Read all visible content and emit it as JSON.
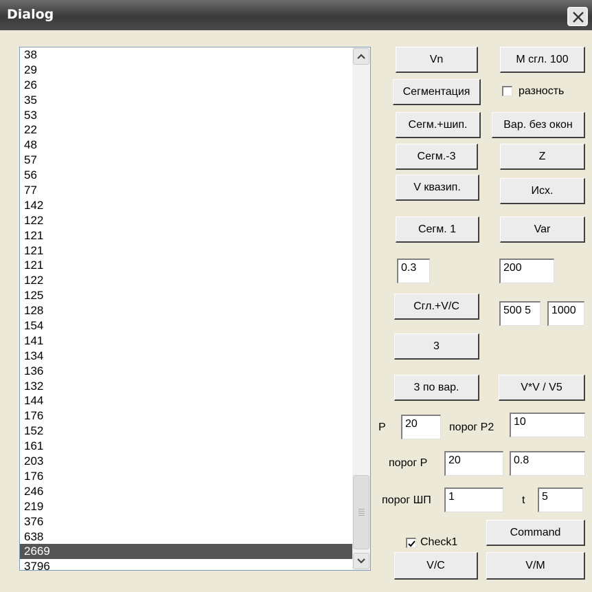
{
  "window": {
    "title": "Dialog"
  },
  "list": {
    "items": [
      "38",
      "29",
      "26",
      "35",
      "53",
      "22",
      "48",
      "57",
      "56",
      "77",
      "142",
      "122",
      "121",
      "121",
      "121",
      "122",
      "125",
      "128",
      "154",
      "141",
      "134",
      "136",
      "132",
      "144",
      "176",
      "152",
      "161",
      "203",
      "176",
      "246",
      "219",
      "376",
      "638",
      "2669",
      "3796"
    ],
    "selected_index": 33
  },
  "buttons": {
    "vn": "Vn",
    "m_sgl_100": "М сгл. 100",
    "segmentation": "Сегментация",
    "seg_ship": "Сегм.+шип.",
    "var_no_windows": "Вар.  без окон",
    "seg3": "Сегм.-3",
    "z": "Z",
    "v_quasi": "V квазип.",
    "source": "Исх.",
    "seg1": "Сегм. 1",
    "var": "Var",
    "sgl_vc": "Сгл.+V/C",
    "three": "3",
    "three_by_var": "3 по вар.",
    "vv_v5": "V*V / V5",
    "command": "Command",
    "vc": "V/C",
    "vm": "V/M"
  },
  "checkboxes": {
    "difference": {
      "label": "разность",
      "checked": false
    },
    "check1": {
      "label": "Check1",
      "checked": true
    }
  },
  "fields": {
    "f_03": "0.3",
    "f_200": "200",
    "f_500_5": "500 5",
    "f_1000": "1000",
    "p": "20",
    "porog_p2": "10",
    "porog_p": "20",
    "f_08": "0.8",
    "porog_shp": "1",
    "t": "5"
  },
  "labels": {
    "p": "P",
    "porog_p2": "порог Р2",
    "porog_p": "порог Р",
    "porog_shp": "порог ШП",
    "t": "t"
  }
}
